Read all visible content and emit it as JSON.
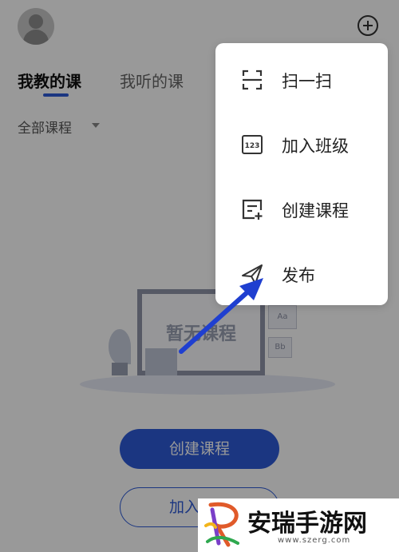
{
  "tabs": {
    "my_teaching": "我教的课",
    "my_listening": "我听的课"
  },
  "filter": {
    "label": "全部课程"
  },
  "empty_state": {
    "text": "暂无课程",
    "card_a": "Aa",
    "card_b": "Bb"
  },
  "buttons": {
    "create_course": "创建课程",
    "join_class": "加入班级"
  },
  "menu": {
    "items": [
      {
        "label": "扫一扫",
        "icon": "scan-icon"
      },
      {
        "label": "加入班级",
        "icon": "class-code-icon"
      },
      {
        "label": "创建课程",
        "icon": "create-course-icon"
      },
      {
        "label": "发布",
        "icon": "send-icon"
      }
    ]
  },
  "watermark": {
    "text": "安瑞手游网",
    "url": "www.szerg.com"
  },
  "colors": {
    "accent": "#2d5bd7",
    "annotation_arrow": "#1f3fd0"
  }
}
